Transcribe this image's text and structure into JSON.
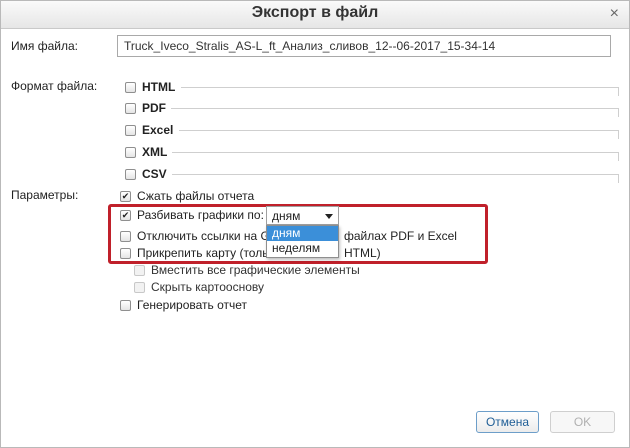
{
  "dialog": {
    "title": "Экспорт в файл",
    "close_glyph": "×"
  },
  "file": {
    "label": "Имя файла:",
    "value": "Truck_Iveco_Stralis_AS-L_ft_Анализ_сливов_12--06-2017_15-34-14"
  },
  "format": {
    "label": "Формат файла:",
    "options": [
      {
        "name": "HTML",
        "checked": false
      },
      {
        "name": "PDF",
        "checked": false
      },
      {
        "name": "Excel",
        "checked": false
      },
      {
        "name": "XML",
        "checked": false
      },
      {
        "name": "CSV",
        "checked": false
      }
    ]
  },
  "params": {
    "label": "Параметры:",
    "compress": "Сжать файлы отчета",
    "split_by": "Разбивать графики по:",
    "split_value": "дням",
    "split_options": [
      "дням",
      "неделям"
    ],
    "disable_links_left": "Отключить ссылки на G",
    "disable_links_right": "файлах PDF и Excel",
    "attach_map_left": "Прикрепить карту (толь",
    "attach_map_right": "HTML)",
    "fit_graphics": "Вместить все графические элементы",
    "hide_basemap": "Скрыть картооснову",
    "generate_report": "Генерировать отчет"
  },
  "buttons": {
    "cancel": "Отмена",
    "ok": "OK"
  },
  "colors": {
    "highlight": "#c0202a",
    "selected_option": "#3b8fd9"
  }
}
